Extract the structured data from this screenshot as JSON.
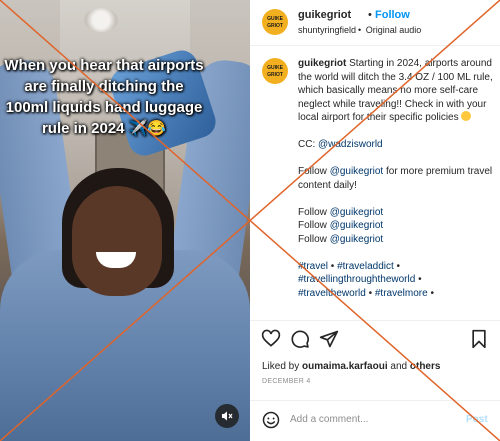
{
  "media": {
    "overlay_text": "When you hear that airports are finally ditching the 100ml liquids hand luggage rule in 2024 ✈️😂",
    "mute_icon": "speaker-muted-icon"
  },
  "header": {
    "avatar_text": "GUIKE GRIOT",
    "username": "guikegriot",
    "separator": "•",
    "follow_label": "Follow",
    "audio_user": "shuntyringfield",
    "audio_sep": "•",
    "audio_label": "Original audio"
  },
  "caption": {
    "avatar_text": "GUIKE GRIOT",
    "username": "guikegriot",
    "body": "Starting in 2024, airports around the world will ditch the 3.4 OZ / 100 ML rule, which basically means no more self-care neglect while traveling!! Check in with your local airport for their specific policies",
    "cc_prefix": "CC: ",
    "cc_handle": "@wadzisworld",
    "follow_prefix": "Follow ",
    "follow_handle": "@guikegriot",
    "follow_suffix": " for more premium travel content daily!",
    "repeat": [
      {
        "prefix": "Follow ",
        "handle": "@guikegriot"
      },
      {
        "prefix": "Follow ",
        "handle": "@guikegriot"
      },
      {
        "prefix": "Follow ",
        "handle": "@guikegriot"
      }
    ],
    "hashtags": [
      "#travel",
      "#traveladdict",
      "#travellingthroughtheworld",
      "#traveltheworld",
      "#travelmore"
    ],
    "hashtag_sep": " • "
  },
  "actions": {
    "icons": [
      "heart-icon",
      "comment-icon",
      "share-icon",
      "bookmark-icon"
    ]
  },
  "likes": {
    "prefix": "Liked by ",
    "user": "oumaima.karfaoui",
    "middle": " and ",
    "others": "others"
  },
  "date": "DECEMBER 4",
  "comment": {
    "placeholder": "Add a comment...",
    "post_label": "Post"
  },
  "colors": {
    "follow": "#0095f6",
    "link": "#00376b",
    "avatar": "#f2b021",
    "watermark": "#e0642a"
  }
}
